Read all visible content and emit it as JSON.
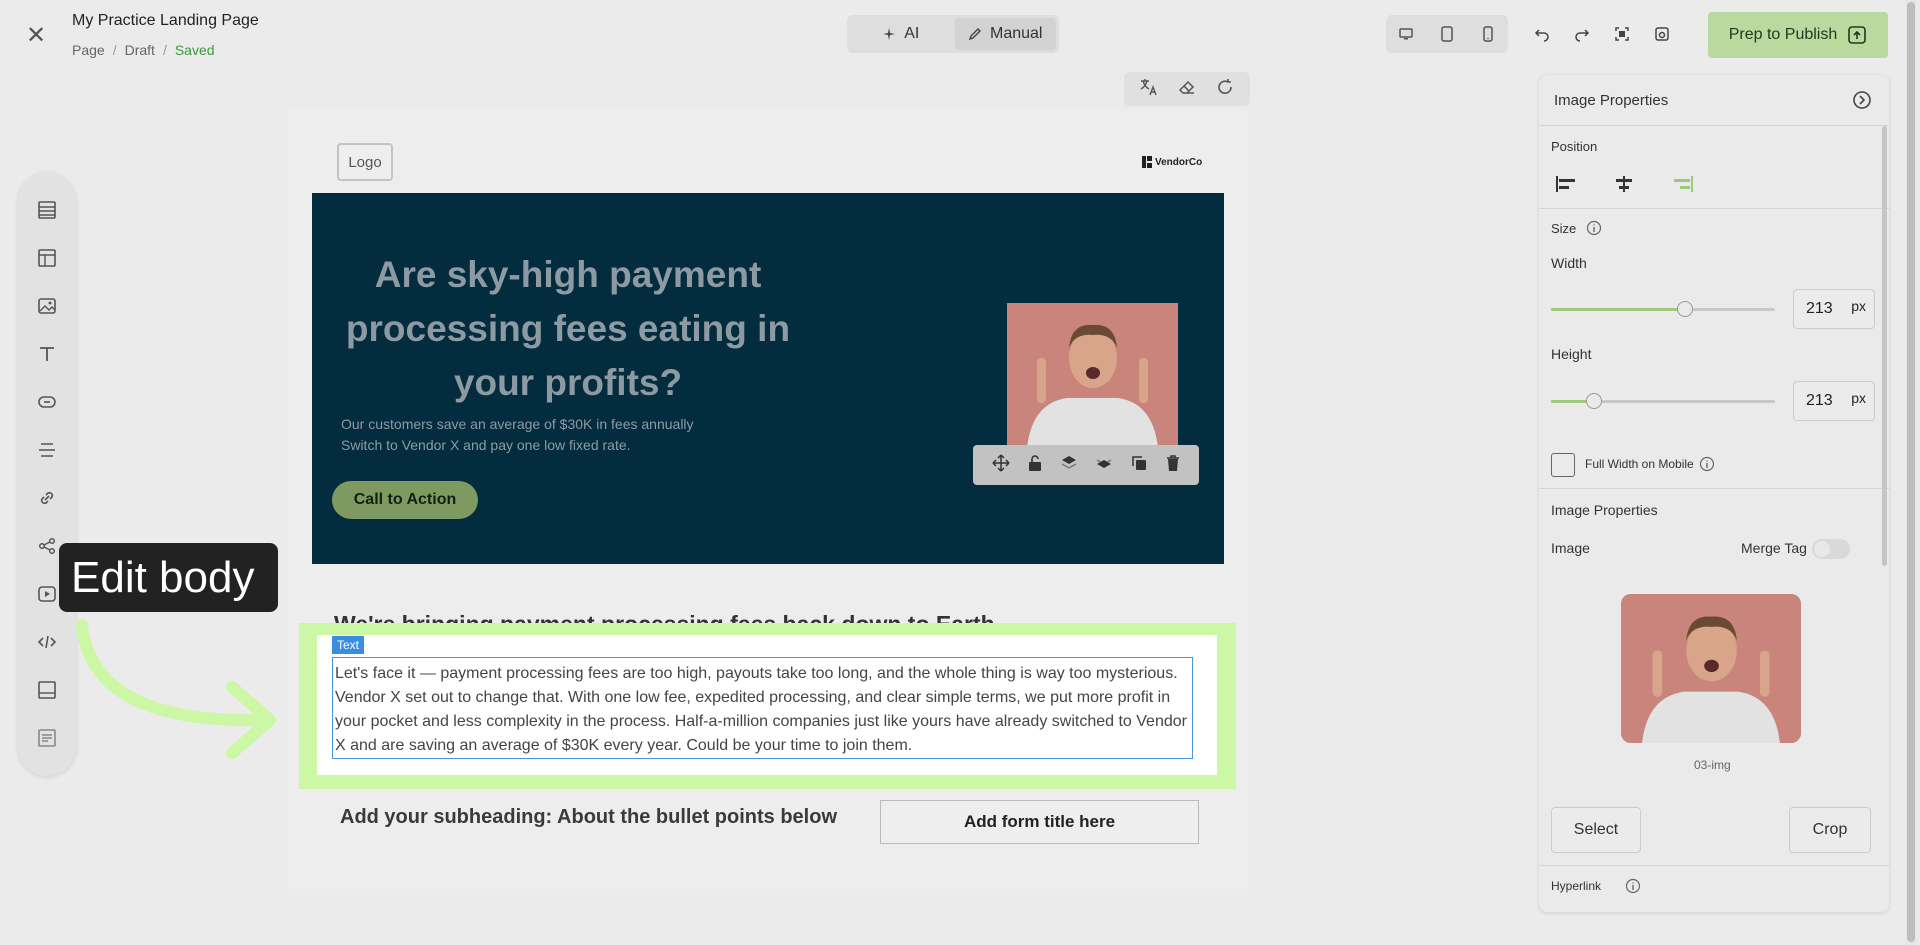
{
  "header": {
    "page_title": "My Practice Landing Page",
    "breadcrumb": [
      "Page",
      "Draft",
      "Saved"
    ],
    "mode_tabs": [
      {
        "label": "AI",
        "icon": "sparkle-icon"
      },
      {
        "label": "Manual",
        "icon": "pencil-icon",
        "active": true
      }
    ],
    "publish_label": "Prep to Publish"
  },
  "canvas": {
    "logo_label": "Logo",
    "brand_name": "VendorCo",
    "hero_title": "Are sky-high payment processing fees eating in your profits?",
    "hero_sub_lines": [
      "Our customers save an average of $30K in fees annually",
      "Switch to Vendor X and pay one low fixed rate."
    ],
    "cta_label": "Call to Action",
    "section_heading": "We're bringing payment processing fees back down to Earth",
    "text_tag": "Text",
    "body_text": "Let's face it — payment processing fees are too high, payouts take too long, and the whole thing is way too mysterious. Vendor X set out to change that. With one low fee, expedited processing, and clear simple terms, we put more profit in your pocket and less complexity in the process. Half-a-million companies just like yours have already switched to Vendor X and are saving an average of $30K every year. Could be your time to join them.",
    "subheading": "Add your subheading: About the bullet points below",
    "form_title": "Add form title here"
  },
  "tooltip": "Edit body",
  "panel": {
    "title": "Image Properties",
    "position_label": "Position",
    "size_label": "Size",
    "width_label": "Width",
    "width_value": "213",
    "width_unit": "px",
    "width_slider": 0.6,
    "height_label": "Height",
    "height_value": "213",
    "height_unit": "px",
    "height_slider": 0.19,
    "full_width_label": "Full Width on Mobile",
    "image_props_label": "Image Properties",
    "image_label": "Image",
    "merge_tag_label": "Merge Tag",
    "image_name": "03-img",
    "select_label": "Select",
    "crop_label": "Crop",
    "hyperlink_label": "Hyperlink"
  },
  "colors": {
    "hero_bg": "#032c3f",
    "publish_bg": "#b9d99e",
    "highlight": "#ccf7a4",
    "cta_bg": "#7e9a60",
    "text_tag": "#3a8ee0"
  }
}
